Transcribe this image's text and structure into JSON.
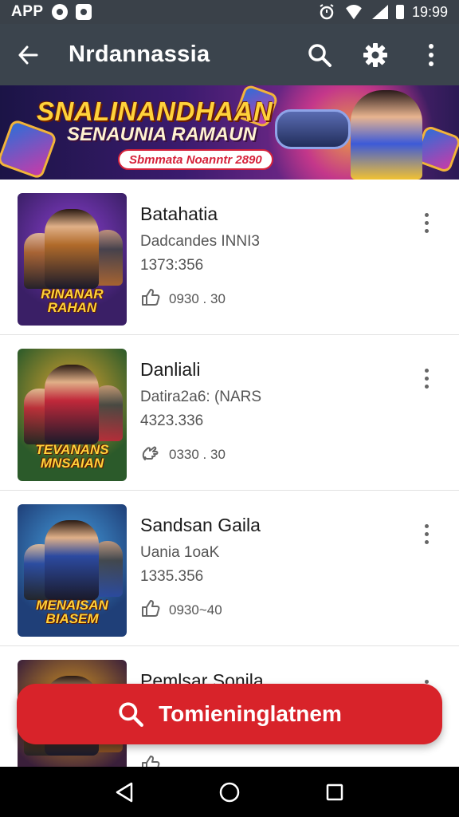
{
  "status_bar": {
    "app_label": "APP",
    "time": "19:99"
  },
  "app_bar": {
    "title": "Nrdannassia",
    "icons": [
      "back-arrow-icon",
      "search-icon",
      "settings-icon",
      "more-vert-icon"
    ]
  },
  "banner": {
    "title": "SNALINANDHAAN",
    "subtitle": "SENAUNIA RAMAUN",
    "tag": "Sbmmata Noanntr 2890"
  },
  "games": [
    {
      "title": "Batahatia",
      "subtitle": "Dadcandes INNI3",
      "number": "1373:356",
      "meta": "0930 . 30",
      "meta_icon": "thumbs-up-icon",
      "thumb_logo": "RINANAR RAHAN",
      "colors": {
        "bg": "#3a1f66",
        "accent": "#8a3fd0",
        "fig": "#b06a2a"
      }
    },
    {
      "title": "Danliali",
      "subtitle": "Datira2a6: (NARS",
      "number": "4323.336",
      "meta": "0330 . 30",
      "meta_icon": "hand-icon",
      "thumb_logo": "TEVANANS MNSAIAN",
      "colors": {
        "bg": "#2b5a2a",
        "accent": "#e0a530",
        "fig": "#c0283a"
      }
    },
    {
      "title": "Sandsan Gaila",
      "subtitle": "Uania 1oaK",
      "number": "1335.356",
      "meta": "0930~40",
      "meta_icon": "thumbs-up-icon",
      "thumb_logo": "MENAISAN BIASEM",
      "colors": {
        "bg": "#1f3f78",
        "accent": "#46a0e0",
        "fig": "#2c4aa0"
      }
    },
    {
      "title": "Pemlsar Sonila",
      "subtitle": "",
      "number": "",
      "meta": "",
      "meta_icon": "thumbs-up-icon",
      "thumb_logo": "",
      "colors": {
        "bg": "#3a1f3a",
        "accent": "#e0a020",
        "fig": "#8a5020"
      }
    }
  ],
  "search_button": {
    "label": "Tomieninglatnem",
    "icon": "search-icon"
  },
  "nav_bar": {
    "icons": [
      "back-triangle-icon",
      "home-circle-icon",
      "recents-square-icon"
    ]
  }
}
